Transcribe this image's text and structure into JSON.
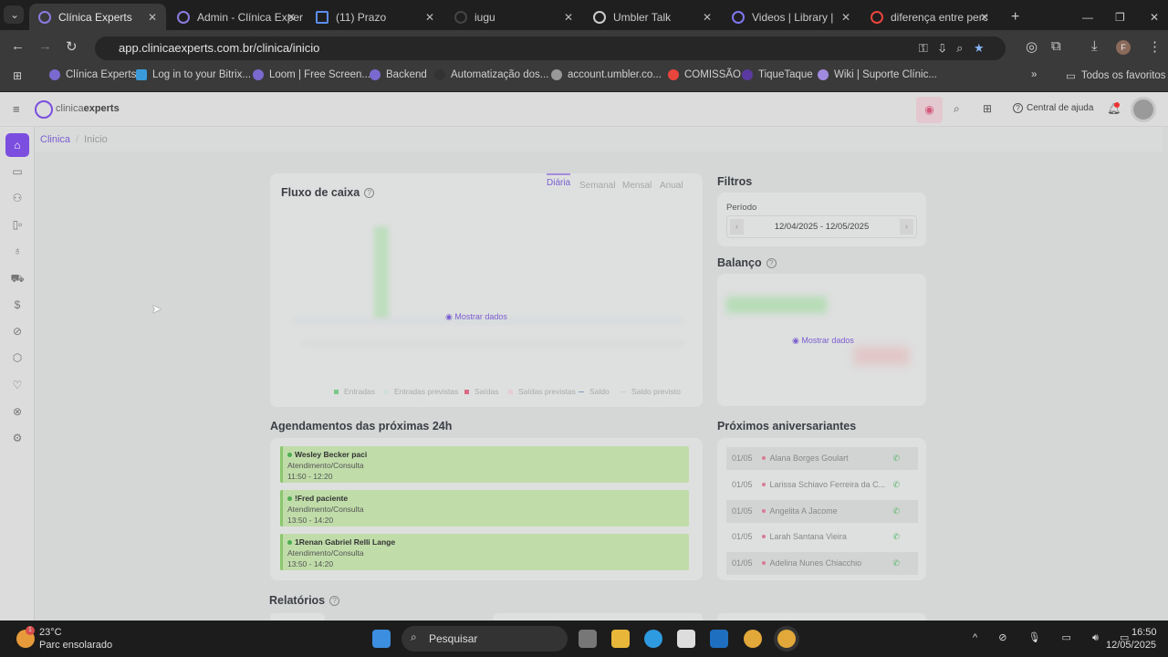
{
  "browser": {
    "tabs": [
      {
        "label": "Clínica Experts",
        "active": true
      },
      {
        "label": "Admin - Clínica Exper"
      },
      {
        "label": "(11) Prazo"
      },
      {
        "label": "iugu"
      },
      {
        "label": "Umbler Talk"
      },
      {
        "label": "Videos | Library |"
      },
      {
        "label": "diferença entre perc"
      }
    ],
    "url": "app.clinicaexperts.com.br/clinica/inicio",
    "bookmarks": [
      "Clínica Experts",
      "Log in to your Bitrix...",
      "Loom | Free Screen...",
      "Backend",
      "Automatização dos...",
      "account.umbler.co...",
      "COMISSÃO",
      "TiqueTaque",
      "Wiki | Suporte Clínic..."
    ],
    "all_bookmarks": "Todos os favoritos",
    "profile_initial": "F"
  },
  "app": {
    "logo_light": "clinica",
    "logo_bold": "experts",
    "help": "Central de ajuda",
    "notification_dot": true
  },
  "sidebar": {
    "items": [
      {
        "icon": "home-icon",
        "active": true
      },
      {
        "icon": "calendar-icon"
      },
      {
        "icon": "users-icon"
      },
      {
        "icon": "kanban-icon"
      },
      {
        "icon": "stethoscope-icon"
      },
      {
        "icon": "cart-icon"
      },
      {
        "icon": "dollar-icon"
      },
      {
        "icon": "gauge-icon"
      },
      {
        "icon": "box-icon"
      },
      {
        "icon": "chat-heart-icon"
      },
      {
        "icon": "cancel-icon"
      },
      {
        "icon": "settings-icon"
      }
    ]
  },
  "breadcrumb": {
    "root": "Clinica",
    "sep": "/",
    "current": "Inicio"
  },
  "cashflow": {
    "title": "Fluxo de caixa",
    "tabs": [
      "Diária",
      "Semanal",
      "Mensal",
      "Anual"
    ],
    "active_tab": "Diária",
    "show_data": "Mostrar dados",
    "legend": [
      "Entradas",
      "Entradas previstas",
      "Saídas",
      "Saídas previstas",
      "Saldo",
      "Saldo previsto"
    ]
  },
  "filters": {
    "title": "Filtros",
    "period_label": "Período",
    "period_value": "12/04/2025 - 12/05/2025"
  },
  "balance": {
    "title": "Balanço",
    "show_data": "Mostrar dados"
  },
  "appointments": {
    "title": "Agendamentos das próximas 24h",
    "items": [
      {
        "name": "Wesley Becker paci",
        "type": "Atendimento/Consulta",
        "time": "11:50 - 12:20"
      },
      {
        "name": "!Fred paciente",
        "type": "Atendimento/Consulta",
        "time": "13:50 - 14:20"
      },
      {
        "name": "1Renan Gabriel Relli Lange",
        "type": "Atendimento/Consulta",
        "time": "13:50 - 14:20"
      }
    ]
  },
  "birthdays": {
    "title": "Próximos aniversariantes",
    "items": [
      {
        "date": "01/05",
        "name": "Alana Borges Goulart"
      },
      {
        "date": "01/05",
        "name": "Larissa Schiavo Ferreira da C..."
      },
      {
        "date": "01/05",
        "name": "Angelita A Jacome"
      },
      {
        "date": "01/05",
        "name": "Larah Santana Vieira"
      },
      {
        "date": "01/05",
        "name": "Adelina Nunes Chiacchio"
      }
    ]
  },
  "reports": {
    "title": "Relatórios"
  },
  "taskbar": {
    "temp": "23°C",
    "weather": "Parc ensolarado",
    "search": "Pesquisar",
    "time": "16:50",
    "date": "12/05/2025",
    "weather_badge": "1"
  }
}
